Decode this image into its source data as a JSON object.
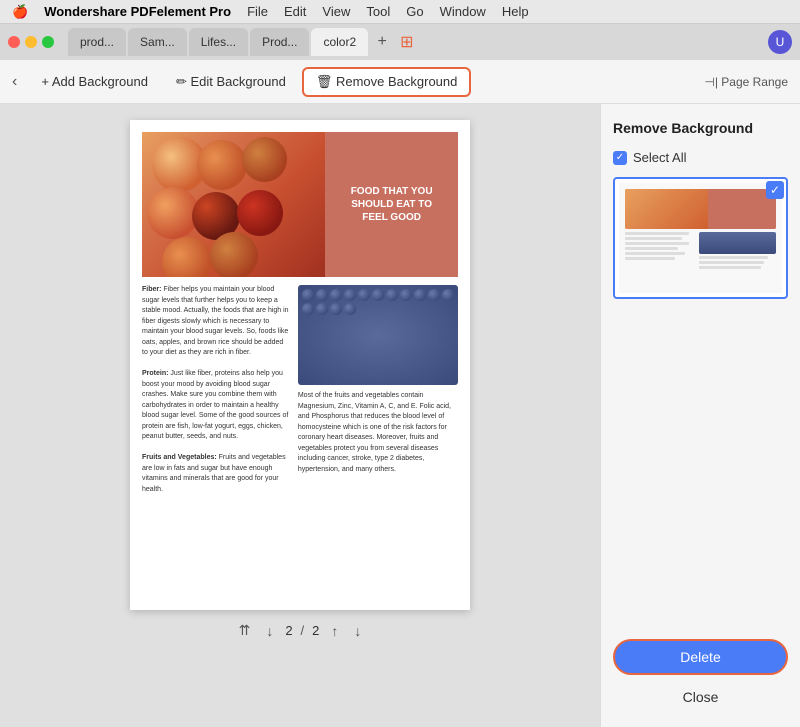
{
  "menubar": {
    "apple": "🍎",
    "app_name": "Wondershare PDFelement Pro",
    "menus": [
      "File",
      "Edit",
      "View",
      "Tool",
      "Go",
      "Window",
      "Help"
    ]
  },
  "tabs": [
    {
      "id": "prod",
      "label": "prod...",
      "active": false
    },
    {
      "id": "sam",
      "label": "Sam...",
      "active": false
    },
    {
      "id": "lifes",
      "label": "Lifes...",
      "active": false
    },
    {
      "id": "prod2",
      "label": "Prod...",
      "active": false
    },
    {
      "id": "color2",
      "label": "color2",
      "active": true
    }
  ],
  "toolbar": {
    "back_label": "‹",
    "add_background_label": "+ Add Background",
    "edit_background_label": "✏ Edit Background",
    "remove_background_label": "🗑 Remove Background",
    "page_range_label": "⊣| Page Range"
  },
  "document": {
    "food_title": "FOOD THAT YOU\nSHOULD EAT TO\nFEEL GOOD",
    "sections": [
      {
        "title": "Fiber:",
        "text": "Fiber helps you maintain your blood sugar levels that further helps you to keep a stable mood. Actually, the foods that are high in fiber digests slowly which is necessary to maintain your blood sugar levels. So, foods like oats, apples, and brown rice should be added to your diet as they are rich in fiber."
      },
      {
        "title": "Protein:",
        "text": "Just like fiber, proteins also help you boost your mood by avoiding blood sugar crashes. Make sure you combine them with carbohydrates in order to maintain a healthy blood sugar level. Some of the good sources of protein are fish, low-fat yogurt, eggs, chicken, peanut butter, seeds, and nuts."
      },
      {
        "title": "Fruits and Vegetables:",
        "text": "Fruits and vegetables are low in fats and sugar but have enough vitamins and minerals that are good for your health."
      }
    ],
    "right_text": "Most of the fruits and vegetables contain Magnesium, Zinc, Vitamin A, C, and E. Folic acid, and Phosphorus that reduces the blood level of homocysteine which is one of the risk factors for coronary heart diseases. Moreover, fruits and vegetables protect you from several diseases including cancer, stroke, type 2 diabetes, hypertension, and many others.",
    "page_current": "2",
    "page_total": "2"
  },
  "right_panel": {
    "title": "Remove Background",
    "select_all_label": "Select All",
    "delete_label": "Delete",
    "close_label": "Close"
  }
}
